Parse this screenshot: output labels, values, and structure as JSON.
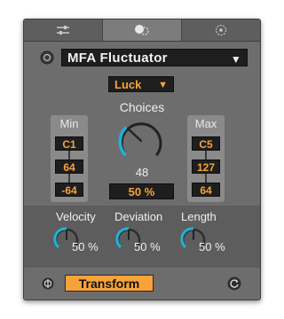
{
  "tabs": [
    {
      "icon": "sliders-icon"
    },
    {
      "icon": "dice-icon",
      "active": true
    },
    {
      "icon": "target-icon"
    }
  ],
  "preset": {
    "label": "MFA Fluctuator",
    "arrow": "▼"
  },
  "mode": {
    "label": "Luck",
    "arrow": "▼"
  },
  "min_panel": {
    "title": "Min",
    "values": [
      "C1",
      "64",
      "-64"
    ]
  },
  "max_panel": {
    "title": "Max",
    "values": [
      "C5",
      "127",
      "64"
    ]
  },
  "choices": {
    "label": "Choices",
    "value": "48",
    "percent": "50 %"
  },
  "params": [
    {
      "label": "Velocity",
      "value": "50 %"
    },
    {
      "label": "Deviation",
      "value": "50 %"
    },
    {
      "label": "Length",
      "value": "50 %"
    }
  ],
  "footer": {
    "transform_label": "Transform"
  },
  "colors": {
    "accent": "#f7a33a",
    "knob_arc": "#1fb3d9",
    "panel_bg": "#6d6d6d"
  }
}
